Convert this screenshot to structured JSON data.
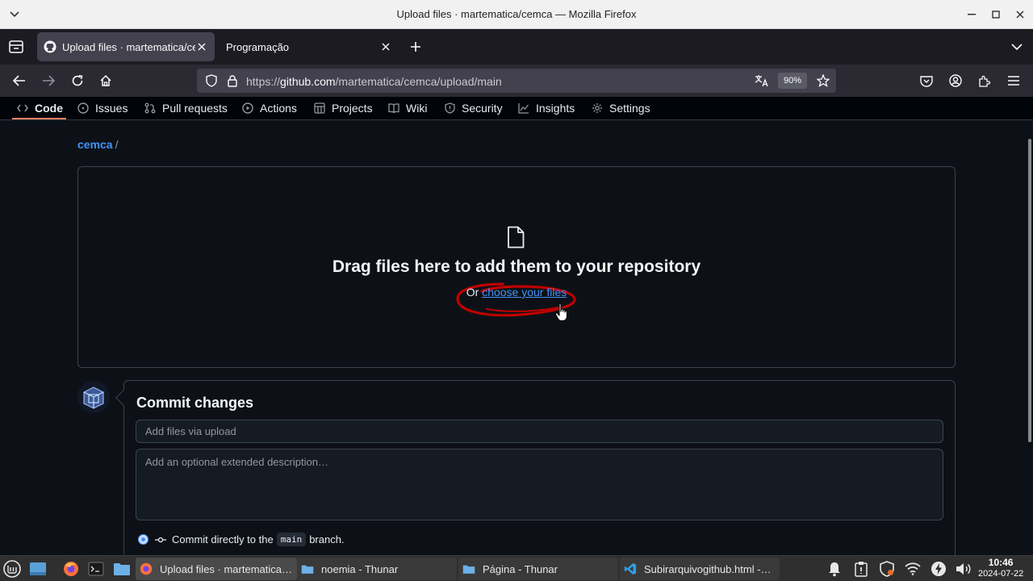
{
  "window": {
    "title": "Upload files · martematica/cemca — Mozilla Firefox"
  },
  "tabs": [
    {
      "label": "Upload files · martematica/cemca",
      "active": true
    },
    {
      "label": "Programação",
      "active": false
    }
  ],
  "navbar": {
    "url_prefix": "https://",
    "url_host": "github.com",
    "url_path": "/martematica/cemca/upload/main",
    "zoom": "90%"
  },
  "repo_nav": {
    "items": [
      "Code",
      "Issues",
      "Pull requests",
      "Actions",
      "Projects",
      "Wiki",
      "Security",
      "Insights",
      "Settings"
    ]
  },
  "breadcrumb": {
    "repo": "cemca",
    "separator": "/"
  },
  "dropzone": {
    "title": "Drag files here to add them to your repository",
    "or_text": "Or",
    "choose_link": "choose your files",
    "annotation_color": "#d40000"
  },
  "commit": {
    "title": "Commit changes",
    "summary_placeholder": "Add files via upload",
    "description_placeholder": "Add an optional extended description…",
    "option_before": "Commit directly to the",
    "branch": "main",
    "option_after": "branch."
  },
  "taskbar": {
    "windows": [
      {
        "label": "Upload files · martematica…",
        "icon": "firefox-icon",
        "active": true
      },
      {
        "label": "noemia - Thunar",
        "icon": "folder-icon",
        "active": false
      },
      {
        "label": "Página - Thunar",
        "icon": "folder-icon",
        "active": false
      },
      {
        "label": "Subirarquivogithub.html -…",
        "icon": "vscode-icon",
        "active": false
      }
    ],
    "time": "10:46",
    "date": "2024-07-22"
  },
  "colors": {
    "accent_link": "#4493f8",
    "page_bg": "#0d1117",
    "tab_underline": "#f78166"
  }
}
